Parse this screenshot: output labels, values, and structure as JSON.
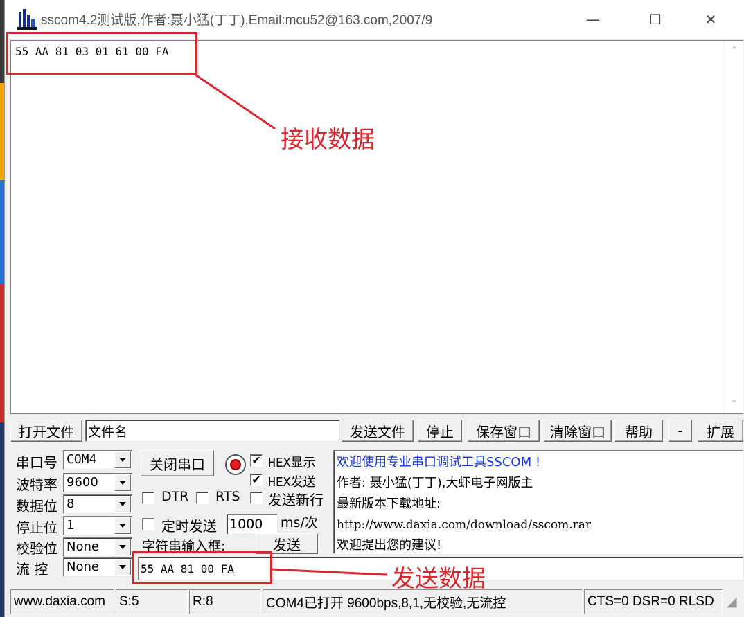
{
  "window": {
    "title": "sscom4.2测试版,作者:聂小猛(丁丁),Email:mcu52@163.com,2007/9",
    "minimize": "—",
    "maximize": "☐",
    "close": "✕"
  },
  "receive": {
    "text": "55 AA 81 03 01 61 00 FA"
  },
  "toolbar": {
    "open_file": "打开文件",
    "file_name": "文件名",
    "send_file": "发送文件",
    "stop": "停止",
    "save_window": "保存窗口",
    "clear_window": "清除窗口",
    "help": "帮助",
    "minus": "-",
    "expand": "扩展"
  },
  "port_settings": {
    "port_label": "串口号",
    "port_value": "COM4",
    "baud_label": "波特率",
    "baud_value": "9600",
    "data_bits_label": "数据位",
    "data_bits_value": "8",
    "stop_bits_label": "停止位",
    "stop_bits_value": "1",
    "parity_label": "校验位",
    "parity_value": "None",
    "flow_label": "流 控",
    "flow_value": "None"
  },
  "controls": {
    "close_port": "关闭串口",
    "hex_display": "HEX显示",
    "hex_send": "HEX发送",
    "dtr": "DTR",
    "rts": "RTS",
    "newline": "发送新行",
    "timed_send": "定时发送",
    "interval": "1000",
    "interval_unit": "ms/次",
    "input_label": "字符串输入框:",
    "send": "发送",
    "send_text": "55 AA 81 00 FA",
    "check_mark": "✔"
  },
  "info": {
    "line1": "欢迎使用专业串口调试工具SSCOM !",
    "line2": "作者: 聂小猛(丁丁),大虾电子网版主",
    "line3": "最新版本下载地址:",
    "line4": "http://www.daxia.com/download/sscom.rar",
    "line5": "欢迎提出您的建议!"
  },
  "status": {
    "site": "www.daxia.com",
    "sent": "S:5",
    "received": "R:8",
    "port_state": "COM4已打开  9600bps,8,1,无校验,无流控",
    "lines": "CTS=0 DSR=0 RLSD"
  },
  "annotations": {
    "receive_label": "接收数据",
    "send_label": "发送数据",
    "color": "#d8282f"
  }
}
